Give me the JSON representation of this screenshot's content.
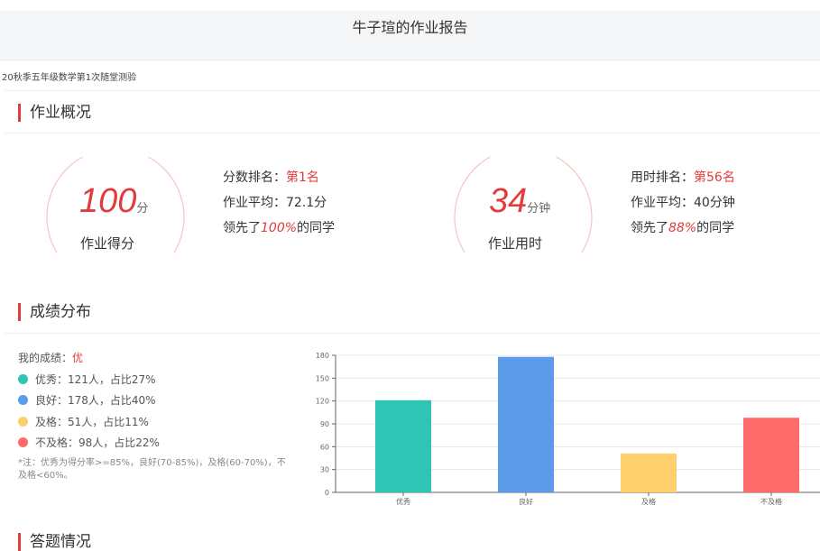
{
  "header": {
    "title": "牛子瑄的作业报告"
  },
  "subtitle": "20秋季五年级数学第1次随堂测验",
  "overview": {
    "section_title": "作业概况",
    "score": {
      "value": "100",
      "unit": "分",
      "caption": "作业得分",
      "rank_label": "分数排名：",
      "rank_value": "第1名",
      "avg_label": "作业平均：",
      "avg_value": "72.1分",
      "lead_prefix": "领先了",
      "lead_value": "100%",
      "lead_suffix": "的同学"
    },
    "time": {
      "value": "34",
      "unit": "分钟",
      "caption": "作业用时",
      "rank_label": "用时排名：",
      "rank_value": "第56名",
      "avg_label": "作业平均：",
      "avg_value": "40分钟",
      "lead_prefix": "领先了",
      "lead_value": "88%",
      "lead_suffix": "的同学"
    }
  },
  "distribution": {
    "section_title": "成绩分布",
    "my_label": "我的成绩：",
    "my_value": "优",
    "items": [
      {
        "text": "优秀：121人，占比27%",
        "color": "#2ec4b6"
      },
      {
        "text": "良好：178人，占比40%",
        "color": "#5b9be8"
      },
      {
        "text": "及格：51人，占比11%",
        "color": "#fdd06b"
      },
      {
        "text": "不及格：98人，占比22%",
        "color": "#fd6b6b"
      }
    ],
    "note": "*注：优秀为得分率>=85%，良好(70-85%)，及格(60-70%)，不及格<60%。"
  },
  "chart_data": {
    "type": "bar",
    "categories": [
      "优秀",
      "良好",
      "及格",
      "不及格"
    ],
    "values": [
      121,
      178,
      51,
      98
    ],
    "colors": [
      "#2ec4b6",
      "#5b9be8",
      "#fdd06b",
      "#fd6b6b"
    ],
    "yticks": [
      0,
      30,
      60,
      90,
      120,
      150,
      180
    ],
    "ylim": [
      0,
      180
    ],
    "grid": true,
    "title": "",
    "xlabel": "",
    "ylabel": ""
  },
  "answers": {
    "section_title": "答题情况"
  }
}
